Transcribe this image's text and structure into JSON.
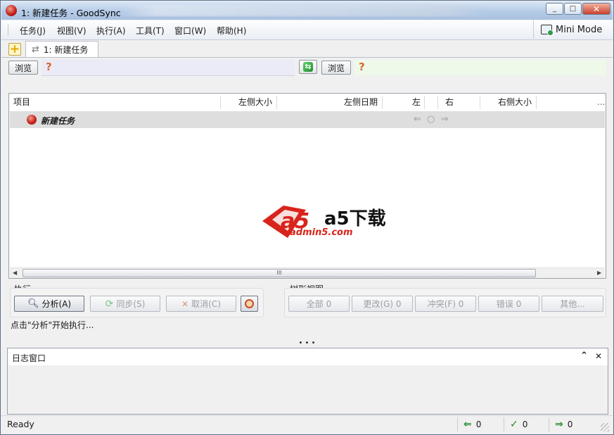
{
  "window": {
    "title": "1: 新建任务 - GoodSync",
    "min": "_",
    "max": "□",
    "close": "✕"
  },
  "menu": [
    "任务(J)",
    "视图(V)",
    "执行(A)",
    "工具(T)",
    "窗口(W)",
    "帮助(H)"
  ],
  "mini_mode": "Mini Mode",
  "tabs": {
    "add": "+",
    "task": "1:  新建任务",
    "arrows": "⇄"
  },
  "paths": {
    "browse_left": "浏览",
    "browse_right": "浏览",
    "q_left": "?",
    "q_right": "?",
    "dir_icon": "⇆"
  },
  "tree": {
    "columns": [
      "项目",
      "左侧大小",
      "左侧日期",
      "左",
      "右",
      "右侧大小",
      "..."
    ],
    "row": {
      "name": "新建任务",
      "controls": "⇐ ○ ⇒"
    },
    "scroll_grip": "III",
    "watermark": {
      "main": "a5下载",
      "sub": "admin5.com"
    }
  },
  "exec": {
    "label": "执行",
    "analyze": "分析(A)",
    "sync": "同步(S)",
    "cancel": "取消(C)",
    "hint": "点击\"分析\"开始执行..."
  },
  "treeview": {
    "label": "树形视图",
    "all": "全部 0",
    "changed": "更改(G) 0",
    "conflict": "冲突(F) 0",
    "error": "错误 0",
    "other": "其他..."
  },
  "splitter": "• • •",
  "log": {
    "title": "日志窗口",
    "collapse": "⌃",
    "close": "✕"
  },
  "status": {
    "text": "Ready",
    "left_count": "0",
    "ok_count": "0",
    "right_count": "0"
  },
  "colors": {
    "title_gradient": "#b7cde8",
    "left_path": "#ebebf8",
    "right_path": "#eef9e9",
    "logo_red": "#d8241c"
  }
}
